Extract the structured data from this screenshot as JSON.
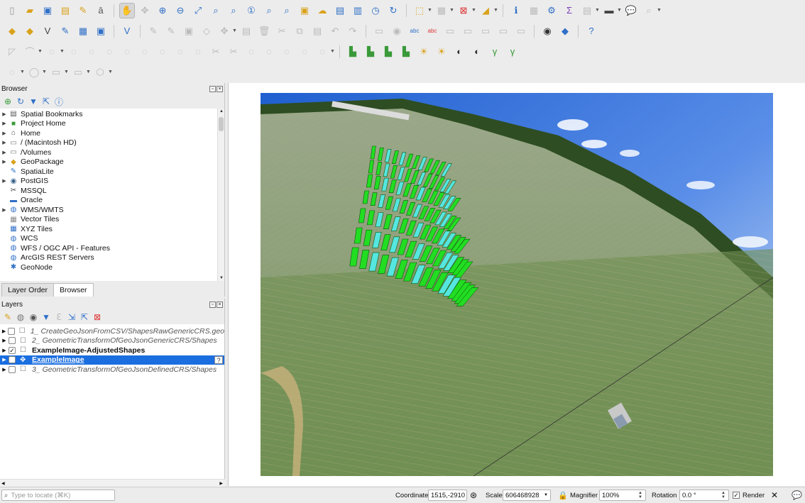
{
  "browser": {
    "title": "Browser",
    "items": [
      {
        "label": "Spatial Bookmarks",
        "icon": "bookmark-icon",
        "glyph": "▤",
        "color": "#555"
      },
      {
        "label": "Project Home",
        "icon": "project-home-icon",
        "glyph": "■",
        "color": "#3a9a3a"
      },
      {
        "label": "Home",
        "icon": "home-icon",
        "glyph": "⌂",
        "color": "#444"
      },
      {
        "label": "/ (Macintosh HD)",
        "icon": "folder-icon",
        "glyph": "▭",
        "color": "#777"
      },
      {
        "label": "/Volumes",
        "icon": "folder-icon",
        "glyph": "▭",
        "color": "#777"
      },
      {
        "label": "GeoPackage",
        "icon": "geopackage-icon",
        "glyph": "◆",
        "color": "#d9a21b"
      },
      {
        "label": "SpatiaLite",
        "icon": "spatialite-icon",
        "glyph": "✎",
        "color": "#2f6fc7"
      },
      {
        "label": "PostGIS",
        "icon": "postgis-icon",
        "glyph": "◉",
        "color": "#335f8a"
      },
      {
        "label": "MSSQL",
        "icon": "mssql-icon",
        "glyph": "✂",
        "color": "#444"
      },
      {
        "label": "Oracle",
        "icon": "oracle-icon",
        "glyph": "▬",
        "color": "#2f6fc7"
      },
      {
        "label": "WMS/WMTS",
        "icon": "wms-icon",
        "glyph": "◍",
        "color": "#2f6fc7"
      },
      {
        "label": "Vector Tiles",
        "icon": "vector-tiles-icon",
        "glyph": "▦",
        "color": "#888"
      },
      {
        "label": "XYZ Tiles",
        "icon": "xyz-tiles-icon",
        "glyph": "▦",
        "color": "#2f6fc7"
      },
      {
        "label": "WCS",
        "icon": "wcs-icon",
        "glyph": "◍",
        "color": "#2f6fc7"
      },
      {
        "label": "WFS / OGC API - Features",
        "icon": "wfs-icon",
        "glyph": "◍",
        "color": "#2f6fc7"
      },
      {
        "label": "ArcGIS REST Servers",
        "icon": "arcgis-icon",
        "glyph": "◍",
        "color": "#2f6fc7"
      },
      {
        "label": "GeoNode",
        "icon": "geonode-icon",
        "glyph": "✱",
        "color": "#2f6fc7"
      }
    ]
  },
  "tabs": [
    "Layer Order",
    "Browser"
  ],
  "layers": {
    "title": "Layers",
    "items": [
      {
        "name": "1_ CreateGeoJsonFromCSV/ShapesRawGenericCRS.geo",
        "checked": false,
        "style": "italic"
      },
      {
        "name": "2_ GeometricTransformOfGeoJsonGenericCRS/Shapes",
        "checked": false,
        "style": "italic"
      },
      {
        "name": "ExampleImage-AdjustedShapes",
        "checked": true,
        "style": "bold"
      },
      {
        "name": "ExampleImage",
        "checked": true,
        "style": "selected"
      },
      {
        "name": "3_ GeometricTransformOfGeoJsonDefinedCRS/Shapes",
        "checked": false,
        "style": "italic"
      }
    ]
  },
  "status": {
    "locate_placeholder": "Type to locate (⌘K)",
    "coordinate_label": "Coordinate",
    "coordinate_value": "1515,-2910",
    "scale_label": "Scale",
    "scale_value": "606468928",
    "magnifier_label": "Magnifier",
    "magnifier_value": "100%",
    "rotation_label": "Rotation",
    "rotation_value": "0.0 °",
    "render_label": "Render"
  },
  "colors": {
    "selection": "#1a6ee0",
    "plot_green": "#22dd22",
    "plot_cyan": "#55e6e0"
  }
}
